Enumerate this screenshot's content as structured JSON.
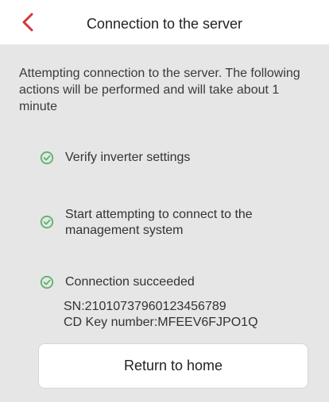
{
  "header": {
    "title": "Connection to the server",
    "back_icon": "chevron-left-icon",
    "back_color": "#d1363a"
  },
  "intro": {
    "text": "Attempting connection to the server. The following actions will be performed and will take about 1 minute"
  },
  "steps": [
    {
      "label": "Verify inverter settings",
      "icon": "check-circle-icon",
      "status": "done"
    },
    {
      "label": "Start attempting to connect to the management system",
      "icon": "check-circle-icon",
      "status": "done"
    },
    {
      "label": "Connection succeeded",
      "icon": "check-circle-icon",
      "status": "done"
    }
  ],
  "result": {
    "sn": "SN:21010737960123456789",
    "cd_key": "CD Key number:MFEEV6FJPO1Q"
  },
  "footer": {
    "return_label": "Return to home"
  },
  "colors": {
    "accent": "#d1363a",
    "success": "#59b36b",
    "background": "#e6e6e6",
    "card": "#ffffff"
  }
}
